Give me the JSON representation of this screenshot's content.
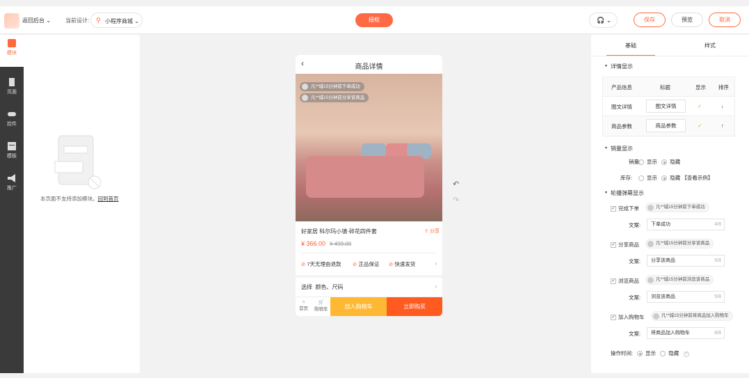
{
  "header": {
    "back_label": "返回后台",
    "current_label": "当前设计:",
    "current_value": "小程序商城",
    "auth_label": "授权",
    "save_label": "保存",
    "preview_label": "预览",
    "cancel_label": "取消"
  },
  "sidebar": {
    "items": [
      {
        "label": "模块"
      },
      {
        "label": "页面"
      },
      {
        "label": "控件"
      },
      {
        "label": "模板"
      },
      {
        "label": "推广"
      }
    ]
  },
  "left_panel": {
    "empty_text": "本页面不支持添加模块。",
    "back_home_link": "回到首页"
  },
  "phone": {
    "title": "商品详情",
    "bubbles": [
      "凡**城15分钟前下单成功",
      "凡**城15分钟前分享该商品"
    ],
    "product_name": "好家居 科尔玛小镇·碎花四件套",
    "share_label": "分享",
    "price": "¥ 366.00",
    "old_price": "¥ 499.00",
    "promises": [
      "7天无理由退款",
      "正品保证",
      "快速发货"
    ],
    "select_label": "选择",
    "select_value": "颜色、尺码",
    "tab_home": "首页",
    "tab_cart": "购物车",
    "add_cart_label": "加入购物车",
    "buy_now_label": "立即购买"
  },
  "right_panel": {
    "tab_base": "基础",
    "tab_style": "样式",
    "detail_section": "详情显示",
    "table_headers": [
      "产品信息",
      "标题",
      "显示",
      "排序"
    ],
    "table_rows": [
      {
        "info": "图文详情",
        "title": "图文详情",
        "sort": "↓"
      },
      {
        "info": "商品参数",
        "title": "商品参数",
        "sort": "↑"
      }
    ],
    "sales_section": "销量显示",
    "sales_label": "销量:",
    "stock_label": "库存:",
    "show": "显示",
    "hide": "隐藏",
    "example_link": "【查看示例】",
    "carousel_section": "轮播弹幕显示",
    "text_label": "文案:",
    "carousel_items": [
      {
        "label": "完成下单",
        "chip": "凡**城15分钟前下单成功",
        "text": "下单成功",
        "count": "4/8"
      },
      {
        "label": "分享商品",
        "chip": "凡**城15分钟前分享该商品",
        "text": "分享该商品",
        "count": "5/8"
      },
      {
        "label": "浏览商品",
        "chip": "凡**城15分钟前浏览该商品",
        "text": "浏览该商品",
        "count": "5/8"
      },
      {
        "label": "加入购物车",
        "chip": "凡**城15分钟前将商品加入购物车",
        "text": "将商品加入购物车",
        "count": "8/8"
      }
    ],
    "op_time_label": "操作时间:",
    "help": "?"
  },
  "colors": {
    "accent": "#ff6a3d",
    "buy": "#ff5a1f",
    "cart": "#ffb833"
  }
}
